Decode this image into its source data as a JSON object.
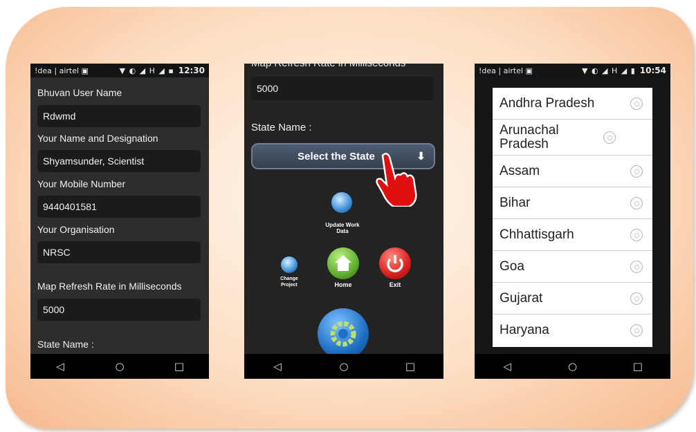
{
  "phone1": {
    "status": {
      "carrier": "!dea | airtel ▣",
      "icons": "▼ ◐ ◢ H ◢ ▪",
      "time": "12:30"
    },
    "fields": [
      {
        "label": "Bhuvan User Name",
        "value": "Rdwmd"
      },
      {
        "label": "Your Name and Designation",
        "value": "Shyamsunder, Scientist"
      },
      {
        "label": "Your Mobile Number",
        "value": "9440401581"
      },
      {
        "label": "Your Organisation",
        "value": "NRSC"
      },
      {
        "label": "Map Refresh Rate in Milliseconds",
        "value": "5000"
      }
    ],
    "state_label": "State Name :"
  },
  "phone2": {
    "top_label_cut": "Map Refresh Rate in Milliseconds",
    "refresh_value": "5000",
    "state_label": "State Name :",
    "select_button": "Select the State",
    "select_arrow": "🡣",
    "menu": {
      "update": "Update Work Data",
      "change": "Change Project",
      "home": "Home",
      "exit": "Exit"
    }
  },
  "phone3": {
    "status": {
      "carrier": "!dea | airtel ▣",
      "icons": "▼ ◐ ◢ H ◢ ▮",
      "time": "10:54"
    },
    "states": [
      "Andhra Pradesh",
      "Arunachal Pradesh",
      "Assam",
      "Bihar",
      "Chhattisgarh",
      "Goa",
      "Gujarat",
      "Haryana"
    ]
  },
  "navbar": {
    "back": "◁",
    "home": "○",
    "recent": "□"
  },
  "colors": {
    "frame_inner": "#fff6ec",
    "frame_outer": "#f6b98e",
    "home_green": "#5fb031",
    "exit_red": "#d8201c",
    "settings_blue": "#1f6fc4"
  }
}
